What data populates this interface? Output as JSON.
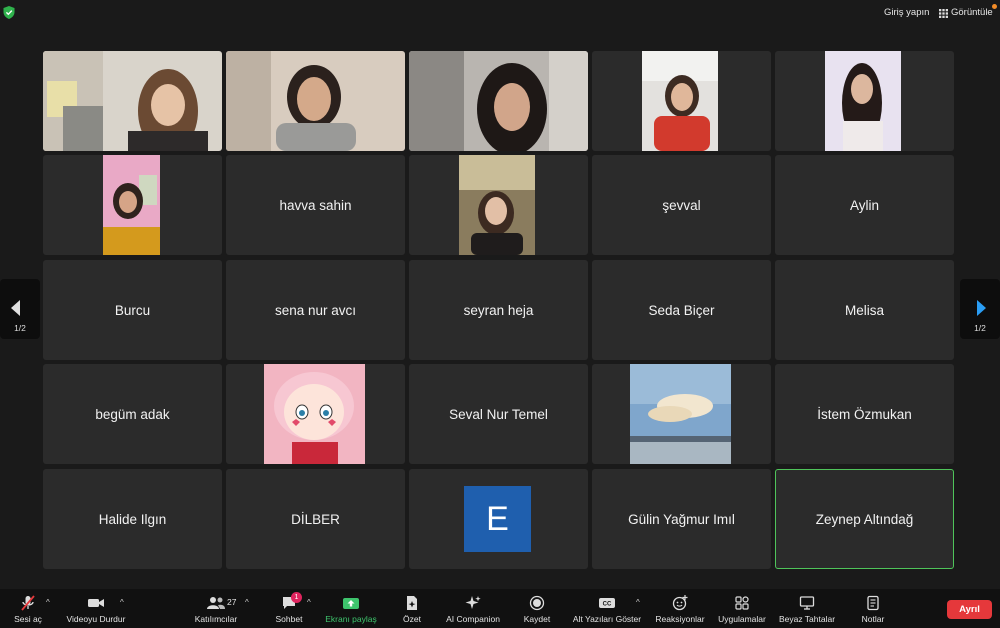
{
  "topbar": {
    "signin_label": "Giriş yapın",
    "view_label": "Görüntüle"
  },
  "pager": {
    "page_label": "1/2"
  },
  "tiles": {
    "r1c1": {
      "name": ""
    },
    "r1c2": {
      "name": ""
    },
    "r1c3": {
      "name": ""
    },
    "r1c4": {
      "name": ""
    },
    "r1c5": {
      "name": ""
    },
    "r2c1": {
      "name": ""
    },
    "r2c2": {
      "name": "havva sahin"
    },
    "r2c3": {
      "name": ""
    },
    "r2c4": {
      "name": "şevval"
    },
    "r2c5": {
      "name": "Aylin"
    },
    "r3c1": {
      "name": "Burcu"
    },
    "r3c2": {
      "name": "sena nur avcı"
    },
    "r3c3": {
      "name": "seyran heja"
    },
    "r3c4": {
      "name": "Seda Biçer"
    },
    "r3c5": {
      "name": "Melisa"
    },
    "r4c1": {
      "name": "begüm adak"
    },
    "r4c2": {
      "name": ""
    },
    "r4c3": {
      "name": "Seval Nur Temel"
    },
    "r4c4": {
      "name": ""
    },
    "r4c5": {
      "name": "İstem Özmukan"
    },
    "r5c1": {
      "name": "Halide Ilgın"
    },
    "r5c2": {
      "name": "DİLBER"
    },
    "r5c3": {
      "name": "",
      "avatar_letter": "E"
    },
    "r5c4": {
      "name": "Gülin Yağmur Imıl"
    },
    "r5c5": {
      "name": "Zeynep Altındağ"
    }
  },
  "toolbar": {
    "mute_label": "Sesi aç",
    "video_label": "Videoyu Durdur",
    "participants_label": "Katılımcılar",
    "participants_count": "27",
    "chat_label": "Sohbet",
    "chat_badge": "1",
    "share_label": "Ekranı paylaş",
    "summary_label": "Özet",
    "ai_label": "AI Companion",
    "record_label": "Kaydet",
    "captions_label": "Alt Yazıları Göster",
    "reactions_label": "Reaksiyonlar",
    "apps_label": "Uygulamalar",
    "whiteboard_label": "Beyaz Tahtalar",
    "notes_label": "Notlar",
    "leave_label": "Ayrıl"
  },
  "colors": {
    "active_speaker": "#4fc45a",
    "leave": "#e5383b",
    "share": "#3ec46d",
    "avatar_e": "#1f5fae"
  }
}
